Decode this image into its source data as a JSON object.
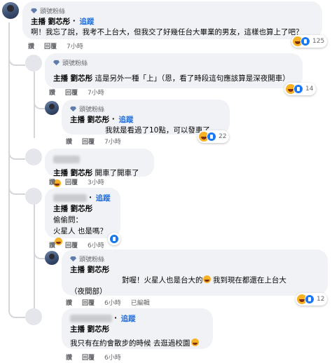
{
  "common": {
    "fan_badge": "頭號粉絲",
    "follow": "追蹤",
    "like": "讚",
    "reply": "回覆",
    "edited": "已編輯"
  },
  "comments": [
    {
      "fan": true,
      "name": "主播 劉芯彤",
      "follow": true,
      "text": "啊！我忘了說，我考不上台大，但我交了好幾任台大畢業的男友，這樣也算上了吧？",
      "time": "7小時",
      "reactions": "125"
    },
    {
      "fan": true,
      "name": "主播 劉芯彤",
      "text": "這是另外一種「上」（恩，看了時段這句應該算是深夜開車）",
      "time": "7小時",
      "reactions": "14"
    },
    {
      "fan": true,
      "name": "主播 劉芯彤",
      "follow": true,
      "text": "我就是看過了10點，可以發車了。",
      "time": "7小時",
      "reactions": "22"
    },
    {
      "name": "主播 劉芯彤",
      "text": "開車了開車了",
      "time": "3小時"
    },
    {
      "follow": true,
      "name": "主播 劉芯彤",
      "text_line1": "偷偷問：",
      "text_line2": "火星人 也是嗎？",
      "time": "6小時"
    },
    {
      "fan": true,
      "name": "主播 劉芯彤",
      "text_line1": "對喔！火星人也是台大的",
      "text_line1b": "我到現在都還在上台大",
      "text_line2": "（夜間部）",
      "time": "6小時",
      "reactions": "12"
    },
    {
      "follow": true,
      "name": "主播 劉芯彤",
      "text": "我只有在約會散步的時候 去逛過校園",
      "time": "6小時"
    }
  ]
}
